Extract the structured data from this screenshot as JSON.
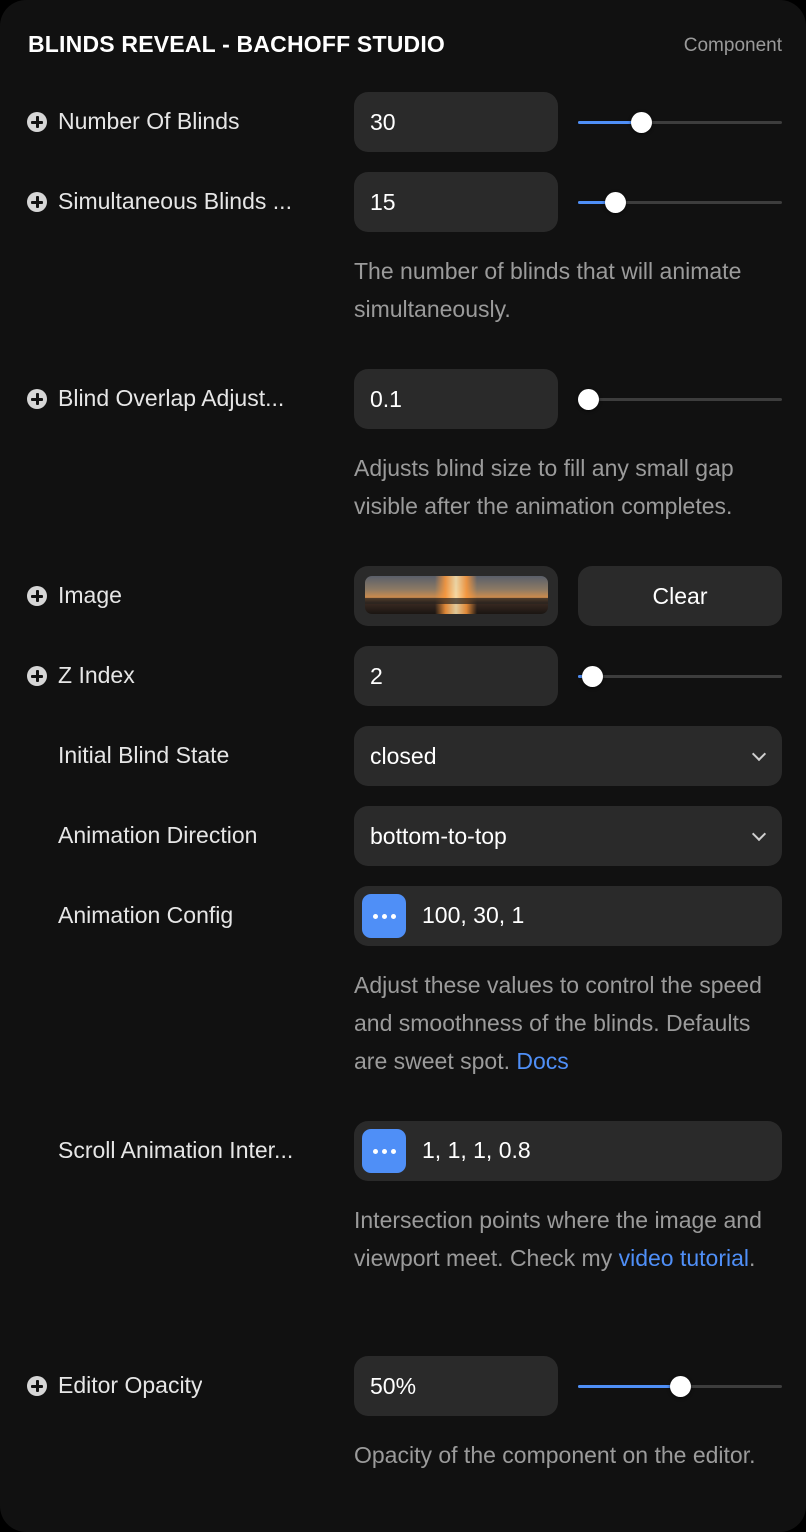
{
  "header": {
    "title": "BLINDS REVEAL - BACHOFF STUDIO",
    "type_label": "Component"
  },
  "colors": {
    "accent": "#4f8ff7",
    "panel_bg": "#111111",
    "field_bg": "#2a2a2a",
    "help_text": "#9b9b9b"
  },
  "number_of_blinds": {
    "label": "Number Of Blinds",
    "value": "30",
    "slider_fraction": 0.31
  },
  "simultaneous_blinds": {
    "label": "Simultaneous Blinds ...",
    "value": "15",
    "slider_fraction": 0.18,
    "help": "The number of blinds that will animate simultaneously."
  },
  "blind_overlap": {
    "label": "Blind Overlap Adjust...",
    "value": "0.1",
    "slider_fraction": 0.05,
    "help": "Adjusts blind size to fill any small gap visible after the animation completes."
  },
  "image": {
    "label": "Image",
    "clear_label": "Clear"
  },
  "z_index": {
    "label": "Z Index",
    "value": "2",
    "slider_fraction": 0.07
  },
  "initial_blind_state": {
    "label": "Initial Blind State",
    "value": "closed"
  },
  "animation_direction": {
    "label": "Animation Direction",
    "value": "bottom-to-top"
  },
  "animation_config": {
    "label": "Animation Config",
    "value": "100, 30, 1",
    "help": "Adjust these values to control the speed and smoothness of the blinds. Defaults are sweet spot.",
    "help_link": "Docs"
  },
  "scroll_animation": {
    "label": "Scroll Animation Inter...",
    "value": "1, 1, 1, 0.8",
    "help": "Intersection points where the image and viewport meet. Check my",
    "help_link": "video tutorial",
    "help_end": "."
  },
  "editor_opacity": {
    "label": "Editor Opacity",
    "value": "50%",
    "slider_fraction": 0.5,
    "help": "Opacity of the component on the editor."
  }
}
